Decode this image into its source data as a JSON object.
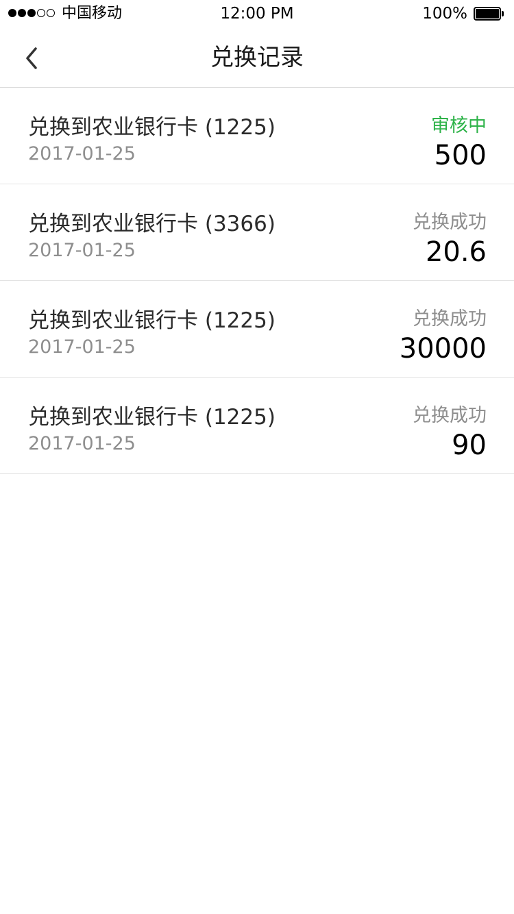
{
  "status_bar": {
    "carrier": "中国移动",
    "time": "12:00 PM",
    "battery": "100%",
    "battery_level": 1.0,
    "signal_bars": 3,
    "signal_total": 5
  },
  "nav": {
    "title": "兑换记录",
    "back_icon": "chevron-left-icon"
  },
  "records": [
    {
      "title": "兑换到农业银行卡 (1225)",
      "date": "2017-01-25",
      "status": "审核中",
      "status_type": "pending",
      "amount": "500"
    },
    {
      "title": "兑换到农业银行卡 (3366)",
      "date": "2017-01-25",
      "status": "兑换成功",
      "status_type": "success",
      "amount": "20.6"
    },
    {
      "title": "兑换到农业银行卡 (1225)",
      "date": "2017-01-25",
      "status": "兑换成功",
      "status_type": "success",
      "amount": "30000"
    },
    {
      "title": "兑换到农业银行卡 (1225)",
      "date": "2017-01-25",
      "status": "兑换成功",
      "status_type": "success",
      "amount": "90"
    }
  ],
  "colors": {
    "pending": "#2fb34a",
    "success": "#8e8e8e",
    "divider": "#e2e2e2"
  }
}
